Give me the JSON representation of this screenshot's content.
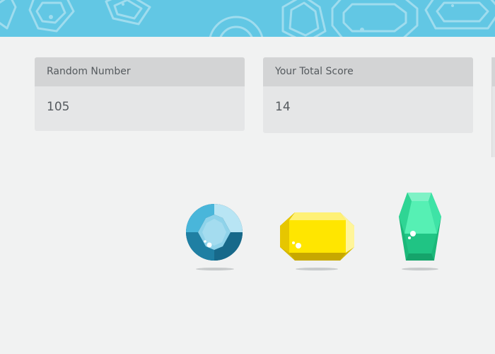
{
  "banner": {
    "background_color": "#62c7e4",
    "pattern_icon": "gem-outline-pattern"
  },
  "stats": {
    "random_number": {
      "label": "Random Number",
      "value": "105"
    },
    "total_score": {
      "label": "Your Total Score",
      "value": "14"
    }
  },
  "gems": [
    {
      "name": "blue-round-gem",
      "icon": "blue-round-gem-icon",
      "color": "#3aa6c9"
    },
    {
      "name": "yellow-octagon-gem",
      "icon": "yellow-octagon-gem-icon",
      "color": "#ffe500"
    },
    {
      "name": "green-crystal-gem",
      "icon": "green-crystal-gem-icon",
      "color": "#2fd594"
    }
  ]
}
